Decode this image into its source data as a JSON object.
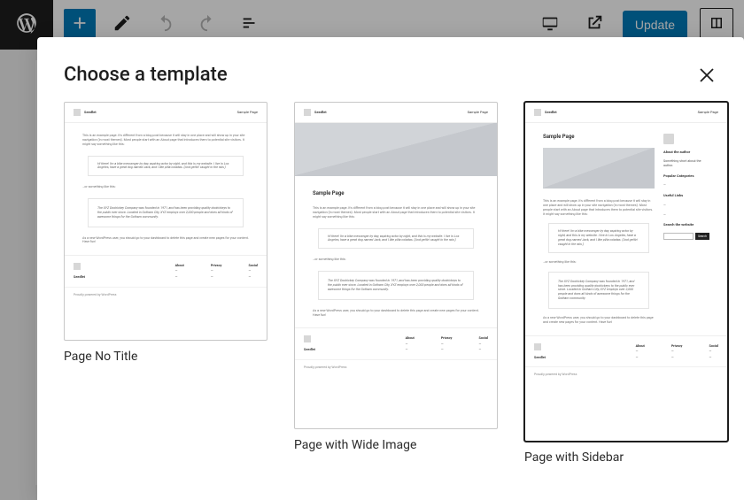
{
  "toolbar": {
    "update_label": "Update"
  },
  "modal": {
    "title": "Choose a template"
  },
  "templates": [
    {
      "label": "Page No Title"
    },
    {
      "label": "Page with Wide Image"
    },
    {
      "label": "Page with Sidebar"
    }
  ],
  "preview": {
    "site_name": "Seedlet",
    "nav_link": "Sample Page",
    "page_title": "Sample Page",
    "intro": "This is an example page. It's different from a blog post because it will stay in one place and will show up in your site navigation (in most themes). Most people start with an About page that introduces them to potential site visitors. It might say something like this:",
    "quote1": "Hi there! I'm a bike messenger by day, aspiring actor by night, and this is my website. I live in Los Angeles, have a great dog named Jack, and I like piña coladas. (And gettin' caught in the rain.)",
    "bridge": "…or something like this:",
    "quote2": "The XYZ Doohickey Company was founded in 1971, and has been providing quality doohickeys to the public ever since. Located in Gotham City, XYZ employs over 2,000 people and does all kinds of awesome things for the Gotham community.",
    "outro": "As a new WordPress user, you should go to your dashboard to delete this page and create new pages for your content. Have fun!",
    "footer": {
      "col1_title": "Seedlet",
      "about_title": "About",
      "privacy_title": "Privacy",
      "social_title": "Social"
    },
    "copyright": "Proudly powered by WordPress",
    "sidebar": {
      "about_author": "About the author",
      "author_blurb": "Something short about the author.",
      "popular_cat": "Popular Categories",
      "useful_links": "Useful Links",
      "search_title": "Search the website",
      "search_btn": "Search"
    }
  }
}
